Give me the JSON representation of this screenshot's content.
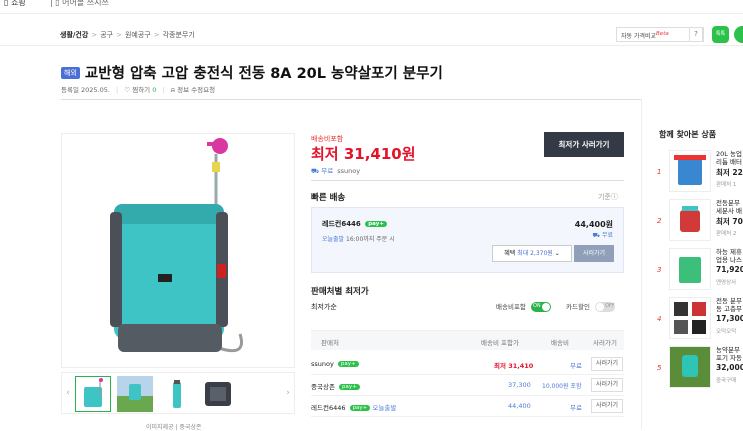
{
  "topbar": {
    "cut_left": "▯ 쇼핑",
    "cut_right": "| ▯ 어어볼 쓰시쓰"
  },
  "breadcrumb": {
    "items": [
      "생활/건강",
      "공구",
      "원예공구",
      "각종분무기"
    ]
  },
  "header": {
    "compare_label": "자동 가격비교",
    "compare_beta": "Beta",
    "help_label": "?",
    "share_label": "톡톡"
  },
  "product": {
    "tag": "해외",
    "title": "교반형 압축 고압 충전식 전동 8A 20L 농약살포기 분무기",
    "registered": "등록일 2025.05.",
    "wish_label": "찜하기",
    "wish_count": "0",
    "report_label": "정보 수정요청"
  },
  "gallery": {
    "prev": "‹",
    "next": "›",
    "source_label": "이미지제공 | 중국상존"
  },
  "pricing": {
    "label": "배송비포함",
    "lowest_price": "최저 31,410원",
    "ship_label": "무료",
    "seller": "ssunoy",
    "buy_button": "최저가 사러가기"
  },
  "fast_delivery": {
    "title": "빠른 배송",
    "guide": "기준ⓘ",
    "seller": "레드컨6446",
    "npay": "pay+",
    "today_label": "오늘출발",
    "today_note": "16:00까지 주문 시",
    "price": "44,400원",
    "ship": "무료",
    "benefit_label": "혜택",
    "benefit_value": "최대 2,370원",
    "buy_label": "사러가기"
  },
  "seller_list": {
    "title": "판매처별 최저가",
    "sort_label": "최저가순",
    "toggle1_label": "배송비포함",
    "toggle1_state": "ON",
    "toggle2_label": "카드할인",
    "toggle2_state": "OFF",
    "columns": [
      "판매처",
      "배송비 포함가",
      "배송비",
      "사러가기"
    ],
    "rows": [
      {
        "seller": "ssunoy",
        "npay": "pay+",
        "extra": "",
        "price": "최저 31,410",
        "ship": "무료",
        "buy": "사러가기"
      },
      {
        "seller": "중국상존",
        "npay": "pay+",
        "extra": "",
        "price": "37,300",
        "ship": "10,000원 포함",
        "buy": "사러가기"
      },
      {
        "seller": "레드컨6446",
        "npay": "pay+",
        "extra": "오늘출발",
        "price": "44,400",
        "ship": "무료",
        "buy": "사러가기"
      }
    ]
  },
  "sidebar": {
    "title": "함께 찾아본 상품",
    "items": [
      {
        "rank": "1",
        "name1": "20L 농업",
        "name2": "리튬 배터",
        "price": "최저 22,",
        "sub": "판매처 1"
      },
      {
        "rank": "2",
        "name1": "전동분무",
        "name2": "세분사 배",
        "price": "최저 70,",
        "sub": "판매처 2"
      },
      {
        "rank": "3",
        "name1": "하능 제휴",
        "name2": "업용 나스",
        "price": "71,920",
        "sub": "엔영상사"
      },
      {
        "rank": "4",
        "name1": "전동 분무",
        "name2": "동 고층무",
        "price": "17,300",
        "sub": "오덕오덕"
      },
      {
        "rank": "5",
        "name1": "농약분무",
        "name2": "포기 자동",
        "price": "32,000",
        "sub": "중국구매"
      }
    ]
  }
}
